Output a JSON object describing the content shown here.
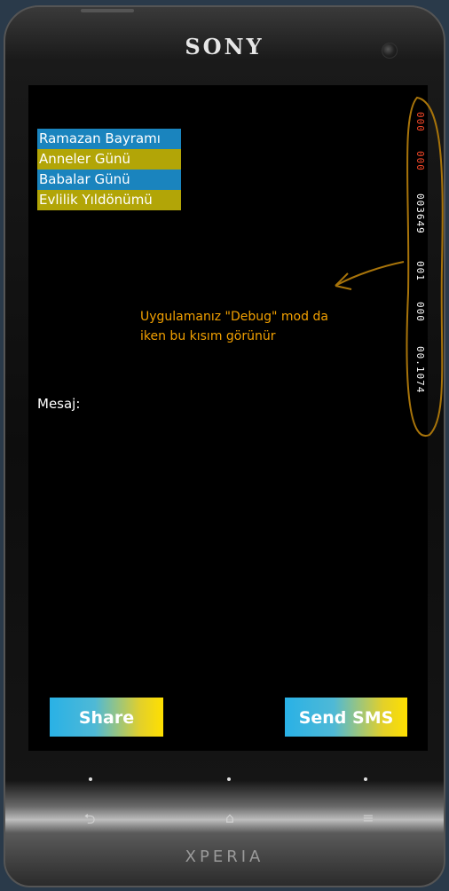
{
  "device": {
    "brand": "SONY",
    "model": "XPERIA"
  },
  "list": {
    "items": [
      {
        "label": "Ramazan Bayramı",
        "color": "#1a84be"
      },
      {
        "label": "Anneler Günü",
        "color": "#b2a507"
      },
      {
        "label": "Babalar Günü",
        "color": "#1a84be"
      },
      {
        "label": "Evlilik Yıldönümü",
        "color": "#b2a507"
      }
    ]
  },
  "annotation": {
    "line1": "Uygulamanız \"Debug\" mod da",
    "line2": "iken bu kısım görünür",
    "color": "#f2a000"
  },
  "message": {
    "label": "Mesaj:"
  },
  "debug_counters": {
    "red_1": "000",
    "red_2": "000",
    "white_1": "003649",
    "white_2": "001",
    "white_3": "000",
    "white_4": "00.1074"
  },
  "buttons": {
    "share": "Share",
    "send_sms": "Send SMS"
  },
  "nav": {
    "back_icon": "back-arrow-icon",
    "home_icon": "home-icon",
    "menu_icon": "menu-icon"
  }
}
